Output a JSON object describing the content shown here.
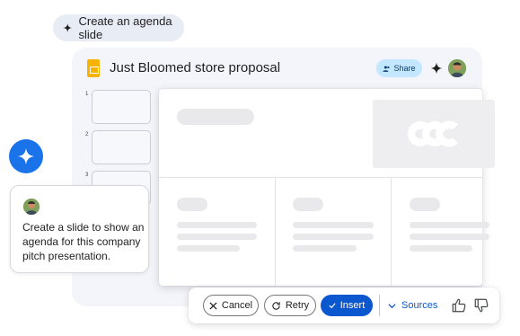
{
  "prompt_chip": {
    "label": "Create an agenda slide",
    "icon": "spark-icon"
  },
  "doc": {
    "title": "Just Bloomed store proposal",
    "share_label": "Share",
    "logo_color": "#f6b300"
  },
  "thumbnails": [
    {
      "number": "1"
    },
    {
      "number": "2"
    },
    {
      "number": "3"
    }
  ],
  "chat": {
    "message": "Create a slide to show an agenda for this company pitch presentation.",
    "assistant_icon": "gemini-spark-icon",
    "assistant_color": "#1a73e8"
  },
  "actions": {
    "cancel_label": "Cancel",
    "retry_label": "Retry",
    "insert_label": "Insert",
    "sources_label": "Sources",
    "accent_color": "#0b57d0"
  }
}
